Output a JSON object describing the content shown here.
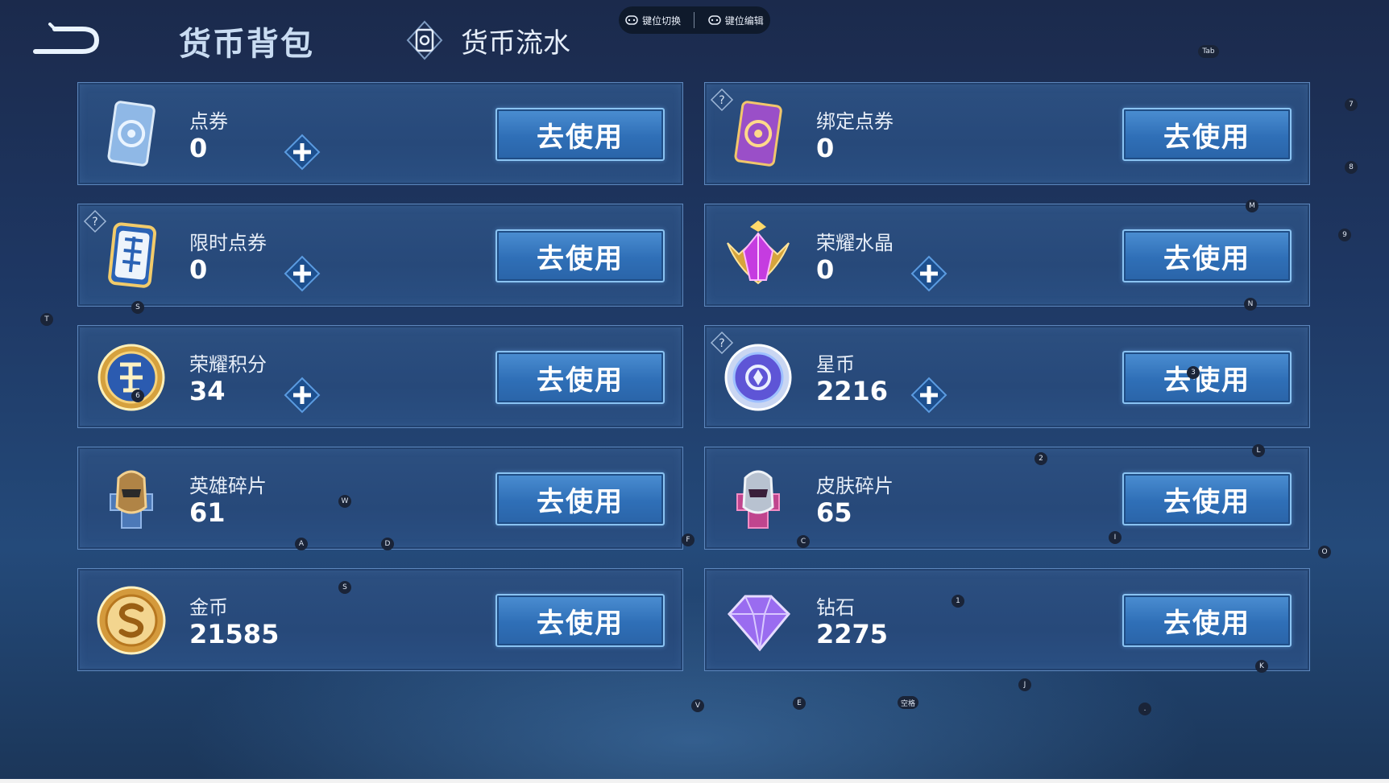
{
  "header": {
    "title": "货币背包",
    "flow_tab": "货币流水",
    "key_switch": "键位切换",
    "key_edit": "键位编辑"
  },
  "use_label": "去使用",
  "cards": [
    {
      "name": "点券",
      "amount": "0",
      "icon": "ticket-card-icon",
      "help": false,
      "plus": true
    },
    {
      "name": "绑定点券",
      "amount": "0",
      "icon": "bound-ticket-card-icon",
      "help": true,
      "plus": false
    },
    {
      "name": "限时点券",
      "amount": "0",
      "icon": "limited-ticket-icon",
      "help": true,
      "plus": true
    },
    {
      "name": "荣耀水晶",
      "amount": "0",
      "icon": "glory-crystal-icon",
      "help": false,
      "plus": true
    },
    {
      "name": "荣耀积分",
      "amount": "34",
      "icon": "glory-points-icon",
      "help": false,
      "plus": true
    },
    {
      "name": "星币",
      "amount": "2216",
      "icon": "star-coin-icon",
      "help": true,
      "plus": true
    },
    {
      "name": "英雄碎片",
      "amount": "61",
      "icon": "hero-shard-icon",
      "help": false,
      "plus": false
    },
    {
      "name": "皮肤碎片",
      "amount": "65",
      "icon": "skin-shard-icon",
      "help": false,
      "plus": false
    },
    {
      "name": "金币",
      "amount": "21585",
      "icon": "gold-coin-icon",
      "help": false,
      "plus": false
    },
    {
      "name": "钻石",
      "amount": "2275",
      "icon": "diamond-icon",
      "help": false,
      "plus": false
    }
  ],
  "key_overlay": [
    "Tab",
    "7",
    "8",
    "M",
    "9",
    "N",
    "T",
    "S",
    "6",
    "3",
    "2",
    "L",
    "W",
    "A",
    "D",
    "F",
    "C",
    "I",
    "O",
    "S",
    "1",
    "K",
    "J",
    "V",
    "E",
    "空格",
    "."
  ],
  "colors": {
    "button_blue": "#3f82c9",
    "card_border": "#5d87bd",
    "background": "#1e3763"
  }
}
